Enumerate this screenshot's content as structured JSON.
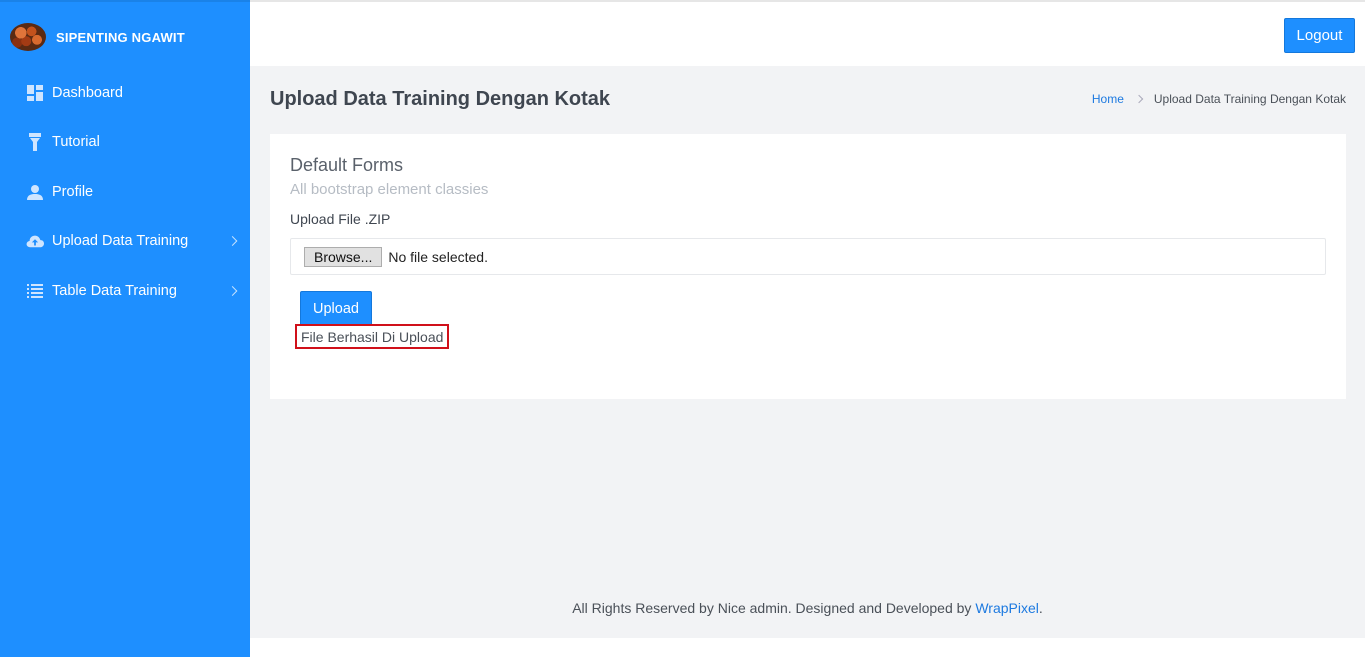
{
  "brand": {
    "name": "SIPENTING NGAWIT",
    "logo_icon": "palm-fruit-logo"
  },
  "sidebar": {
    "items": [
      {
        "label": "Dashboard",
        "icon": "dashboard-icon",
        "has_submenu": false
      },
      {
        "label": "Tutorial",
        "icon": "flashlight-icon",
        "has_submenu": false
      },
      {
        "label": "Profile",
        "icon": "user-icon",
        "has_submenu": false
      },
      {
        "label": "Upload Data Training",
        "icon": "cloud-upload-icon",
        "has_submenu": true
      },
      {
        "label": "Table Data Training",
        "icon": "list-icon",
        "has_submenu": true
      }
    ]
  },
  "topbar": {
    "logout_label": "Logout"
  },
  "page": {
    "title": "Upload Data Training Dengan Kotak",
    "breadcrumb": {
      "home": "Home",
      "current": "Upload Data Training Dengan Kotak"
    }
  },
  "card": {
    "title": "Default Forms",
    "subtitle": "All bootstrap element classies",
    "field_label": "Upload File .ZIP",
    "browse_label": "Browse...",
    "file_status": "No file selected.",
    "upload_label": "Upload",
    "success_message": "File Berhasil Di Upload"
  },
  "footer": {
    "text": "All Rights Reserved by Nice admin. Designed and Developed by ",
    "link": "WrapPixel",
    "suffix": "."
  },
  "colors": {
    "primary": "#1e8fff",
    "success_border": "#d0101a",
    "link": "#1e7ae0"
  }
}
